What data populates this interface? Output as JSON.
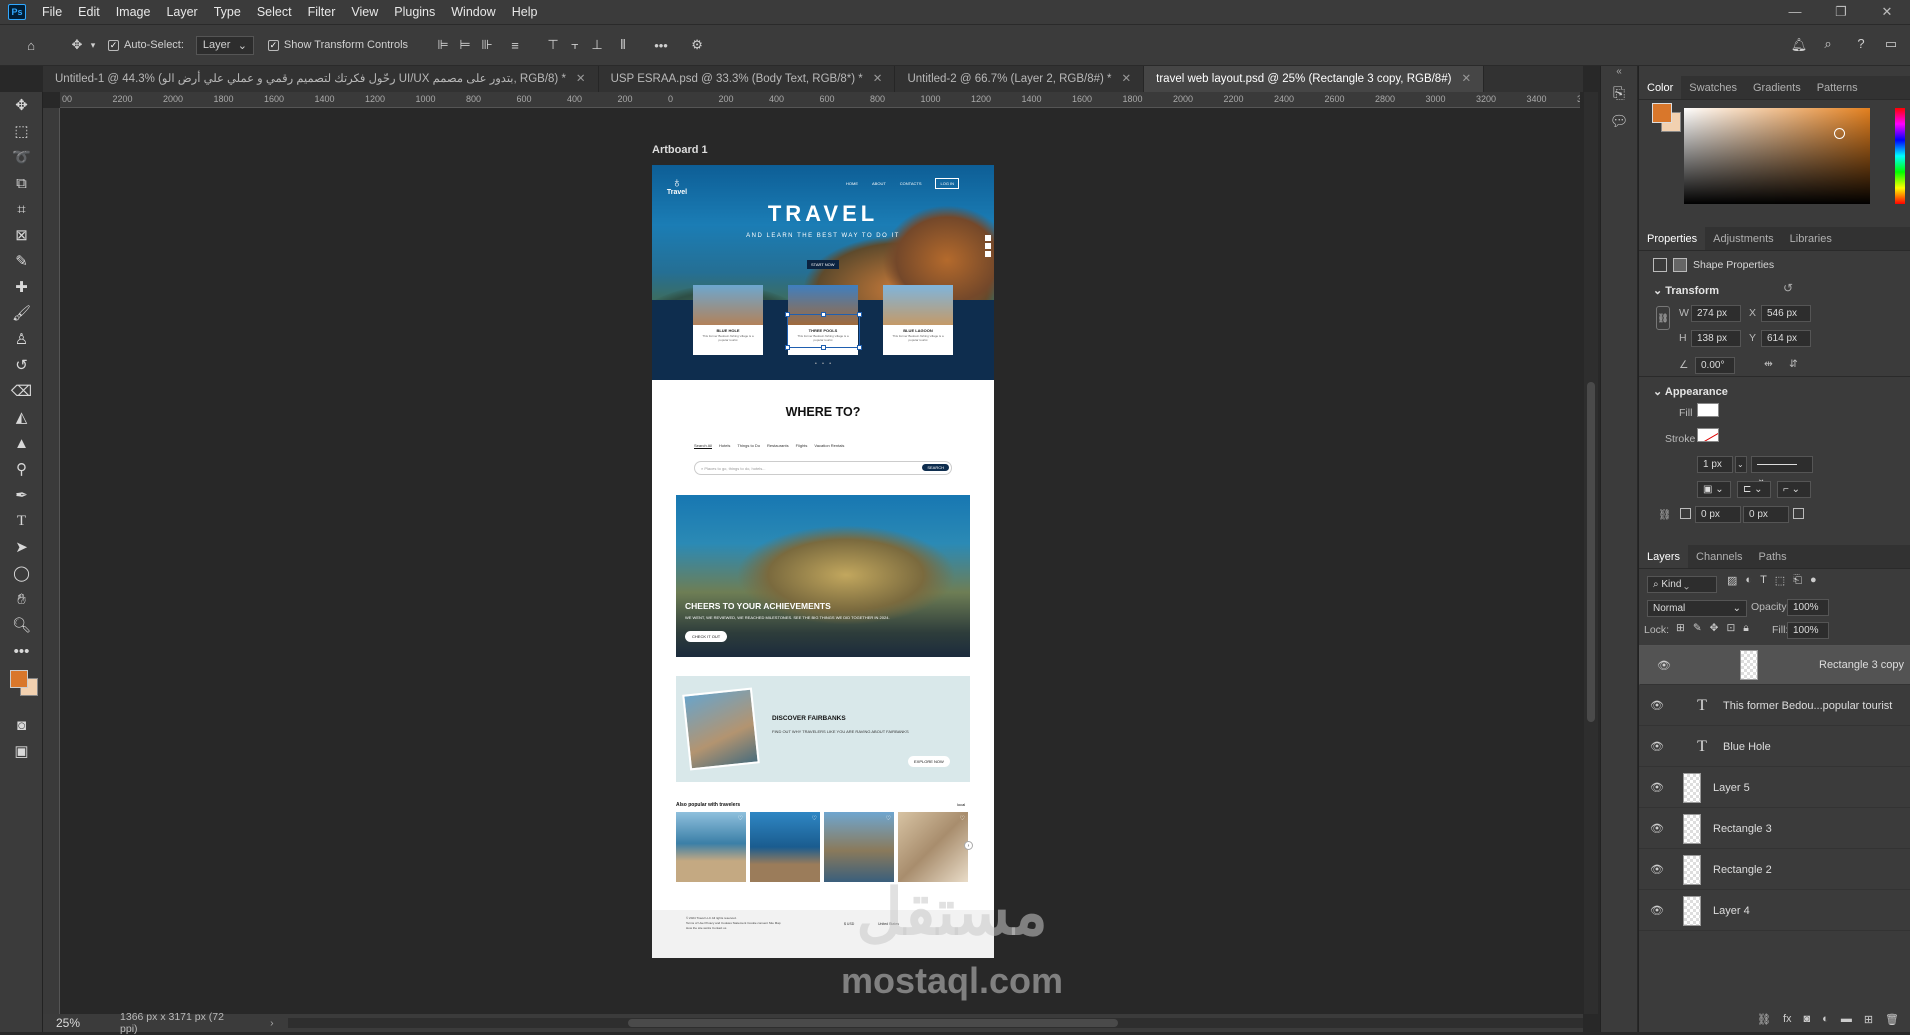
{
  "app": {
    "logo": "Ps"
  },
  "menu": [
    "File",
    "Edit",
    "Image",
    "Layer",
    "Type",
    "Select",
    "Filter",
    "View",
    "Plugins",
    "Window",
    "Help"
  ],
  "options": {
    "auto_select": "Auto-Select:",
    "layer_select": "Layer",
    "show_transform": "Show Transform Controls"
  },
  "tabs": [
    {
      "label": "Untitled-1 @ 44.3% (رحّول فكرتك لتصميم رقمي و عملي علي أرض الو UI/UX بتدور على مصمم, RGB/8) *",
      "active": false
    },
    {
      "label": "USP ESRAA.psd @ 33.3% (Body Text, RGB/8*) *",
      "active": false
    },
    {
      "label": "Untitled-2 @ 66.7% (Layer 2, RGB/8#) *",
      "active": false
    },
    {
      "label": "travel web layout.psd @ 25% (Rectangle 3 copy, RGB/8#)",
      "active": true
    }
  ],
  "ruler_marks": [
    "00",
    "2200",
    "2000",
    "1800",
    "1600",
    "1400",
    "1200",
    "1000",
    "800",
    "600",
    "400",
    "200",
    "0",
    "200",
    "400",
    "600",
    "800",
    "1000",
    "1200",
    "1400",
    "1600",
    "1800",
    "2000",
    "2200",
    "2400",
    "2600",
    "2800",
    "3000",
    "3200",
    "3400",
    "3600"
  ],
  "artboard_label": "Artboard 1",
  "site": {
    "logo_text": "Travel",
    "nav": [
      "HOME",
      "ABOUT",
      "CONTACTS",
      "LOG IN"
    ],
    "hero_title": "TRAVEL",
    "hero_sub": "AND LEARN THE BEST WAY TO DO IT",
    "hero_btn": "START NOW",
    "cards": [
      {
        "title": "BLUE HOLE",
        "text": "This former Bedouin fishing village is a popular tourist"
      },
      {
        "title": "THREE POOLS",
        "text": "This former Bedouin fishing village is a popular tourist"
      },
      {
        "title": "BLUE LAGOON",
        "text": "This former Bedouin fishing village is a popular tourist"
      }
    ],
    "where_title": "WHERE TO?",
    "search_tabs": [
      "Search All",
      "Hotels",
      "Things to Do",
      "Restaurants",
      "Flights",
      "Vacation Rentals"
    ],
    "search_placeholder": "Places to go, things to do, hotels...",
    "search_btn": "SEARCH",
    "promo_title": "CHEERS TO YOUR ACHIEVEMENTS",
    "promo_text": "WE WENT, WE REVIEWED, WE REACHED MILESTONES. SEE THE BIG THINGS WE DID TOGETHER IN 2024.",
    "promo_btn": "CHECK IT OUT",
    "discover_title": "DISCOVER FAIRBANKS",
    "discover_text": "FIND OUT WHY TRAVELERS LIKE YOU ARE RAVING ABOUT FAIRBANKS",
    "discover_btn": "EXPLORE NOW",
    "popular_title": "Also popular with travelers",
    "popular_link": "local",
    "footer_lines": [
      "© 2024 Travel LLC All rights reserved.",
      "Terms of Use   Privacy and Cookies Statement   Cookie consent   Site Map",
      "How the site works   Contact us"
    ],
    "footer_currency": "$ USD",
    "footer_country": "United States"
  },
  "watermark": {
    "arabic": "مستقل",
    "latin": "mostaql.com"
  },
  "status": {
    "zoom": "25%",
    "doc_size": "1366 px x 3171 px (72 ppi)"
  },
  "color_panel": {
    "tabs": [
      "Color",
      "Swatches",
      "Gradients",
      "Patterns"
    ],
    "fg": "#d9772b",
    "bg": "#f2d1b0"
  },
  "properties": {
    "tabs": [
      "Properties",
      "Adjustments",
      "Libraries"
    ],
    "kind": "Shape Properties",
    "transform_label": "Transform",
    "w_label": "W",
    "w": "274 px",
    "x_label": "X",
    "x": "546 px",
    "h_label": "H",
    "h": "138 px",
    "y_label": "Y",
    "y": "614 px",
    "angle": "0.00°",
    "appearance_label": "Appearance",
    "fill_label": "Fill",
    "stroke_label": "Stroke",
    "stroke_width": "1 px",
    "radius_a": "0 px",
    "radius_b": "0 px"
  },
  "layers_panel": {
    "tabs": [
      "Layers",
      "Channels",
      "Paths"
    ],
    "kind": "Kind",
    "blend": "Normal",
    "opacity_label": "Opacity:",
    "opacity": "100%",
    "lock_label": "Lock:",
    "fill_label": "Fill:",
    "fill": "100%",
    "rows": [
      {
        "name": "Rectangle 3 copy",
        "type": "shape",
        "selected": true
      },
      {
        "name": "This former Bedou...popular tourist",
        "type": "text",
        "selected": false
      },
      {
        "name": "Blue Hole",
        "type": "text",
        "selected": false
      },
      {
        "name": "Layer 5",
        "type": "pixel",
        "selected": false
      },
      {
        "name": "Rectangle 3",
        "type": "shape",
        "selected": false
      },
      {
        "name": "Rectangle 2",
        "type": "shape",
        "selected": false
      },
      {
        "name": "Layer 4",
        "type": "pixel",
        "selected": false
      }
    ]
  }
}
